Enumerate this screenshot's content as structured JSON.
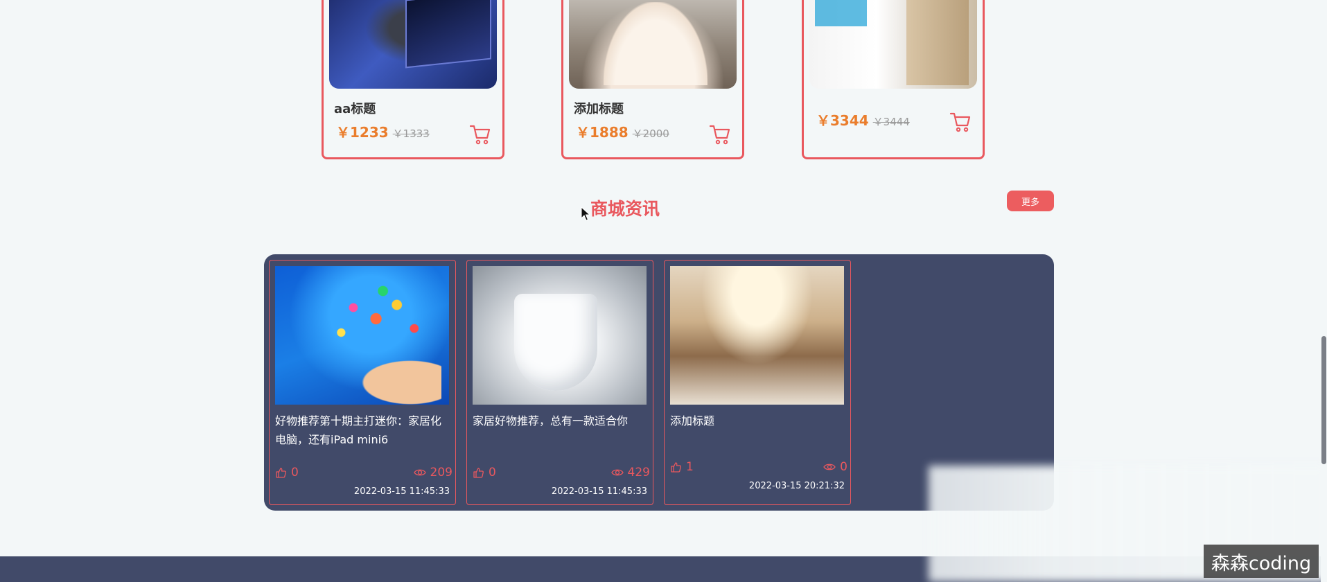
{
  "products": [
    {
      "title": "aa标题",
      "price": "￥1233",
      "old_price": "￥1333",
      "image": "tv-product-image"
    },
    {
      "title": "添加标题",
      "price": "￥1888",
      "old_price": "￥2000",
      "image": "wedding-dress-image"
    },
    {
      "title": "",
      "price": "￥3344",
      "old_price": "￥3444",
      "image": "refrigerator-image"
    }
  ],
  "news_section": {
    "title": "商城资讯",
    "more_label": "更多",
    "items": [
      {
        "title": "好物推荐第十期主打迷你：家居化电脑，还有iPad mini6",
        "likes": "0",
        "views": "209",
        "date": "2022-03-15 11:45:33"
      },
      {
        "title": "家居好物推荐，总有一款适合你",
        "likes": "0",
        "views": "429",
        "date": "2022-03-15 11:45:33"
      },
      {
        "title": "添加标题",
        "likes": "1",
        "views": "0",
        "date": "2022-03-15 20:21:32"
      }
    ]
  },
  "watermark": "森森coding",
  "icons": [
    "cart-icon",
    "thumbs-up-icon",
    "eye-icon",
    "mouse-cursor-icon"
  ],
  "colors": {
    "accent": "#e9585e",
    "price": "#ea7d2c",
    "panel": "#414a69",
    "background": "#f3f7f8"
  }
}
